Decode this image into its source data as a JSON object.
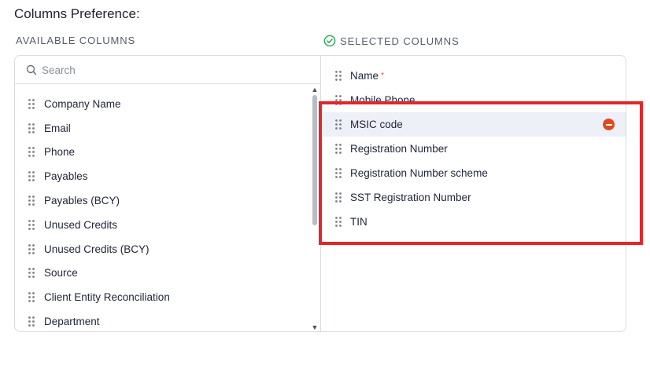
{
  "page": {
    "title": "Columns Preference:"
  },
  "available": {
    "label": "AVAILABLE COLUMNS",
    "search_placeholder": "Search",
    "items": [
      {
        "label": "Company Name"
      },
      {
        "label": "Email"
      },
      {
        "label": "Phone"
      },
      {
        "label": "Payables"
      },
      {
        "label": "Payables (BCY)"
      },
      {
        "label": "Unused Credits"
      },
      {
        "label": "Unused Credits (BCY)"
      },
      {
        "label": "Source"
      },
      {
        "label": "Client Entity Reconciliation"
      },
      {
        "label": "Department"
      }
    ],
    "scroll_position": 0
  },
  "selected": {
    "label": "SELECTED COLUMNS",
    "required_marker": "*",
    "items": [
      {
        "label": "Name"
      },
      {
        "label": "Mobile Phone"
      },
      {
        "label": "MSIC code"
      },
      {
        "label": "Registration Number"
      },
      {
        "label": "Registration Number scheme"
      },
      {
        "label": "SST Registration Number"
      },
      {
        "label": "TIN"
      }
    ]
  },
  "icons": {
    "check": "check-circle-icon",
    "search": "search-icon",
    "grip": "drag-handle-icon",
    "remove": "remove-circle-icon"
  },
  "colors": {
    "accent_green": "#2aa55a",
    "remove_red": "#e04a1f",
    "highlight_red": "#e3262b",
    "hover_row": "#eef0f8"
  }
}
